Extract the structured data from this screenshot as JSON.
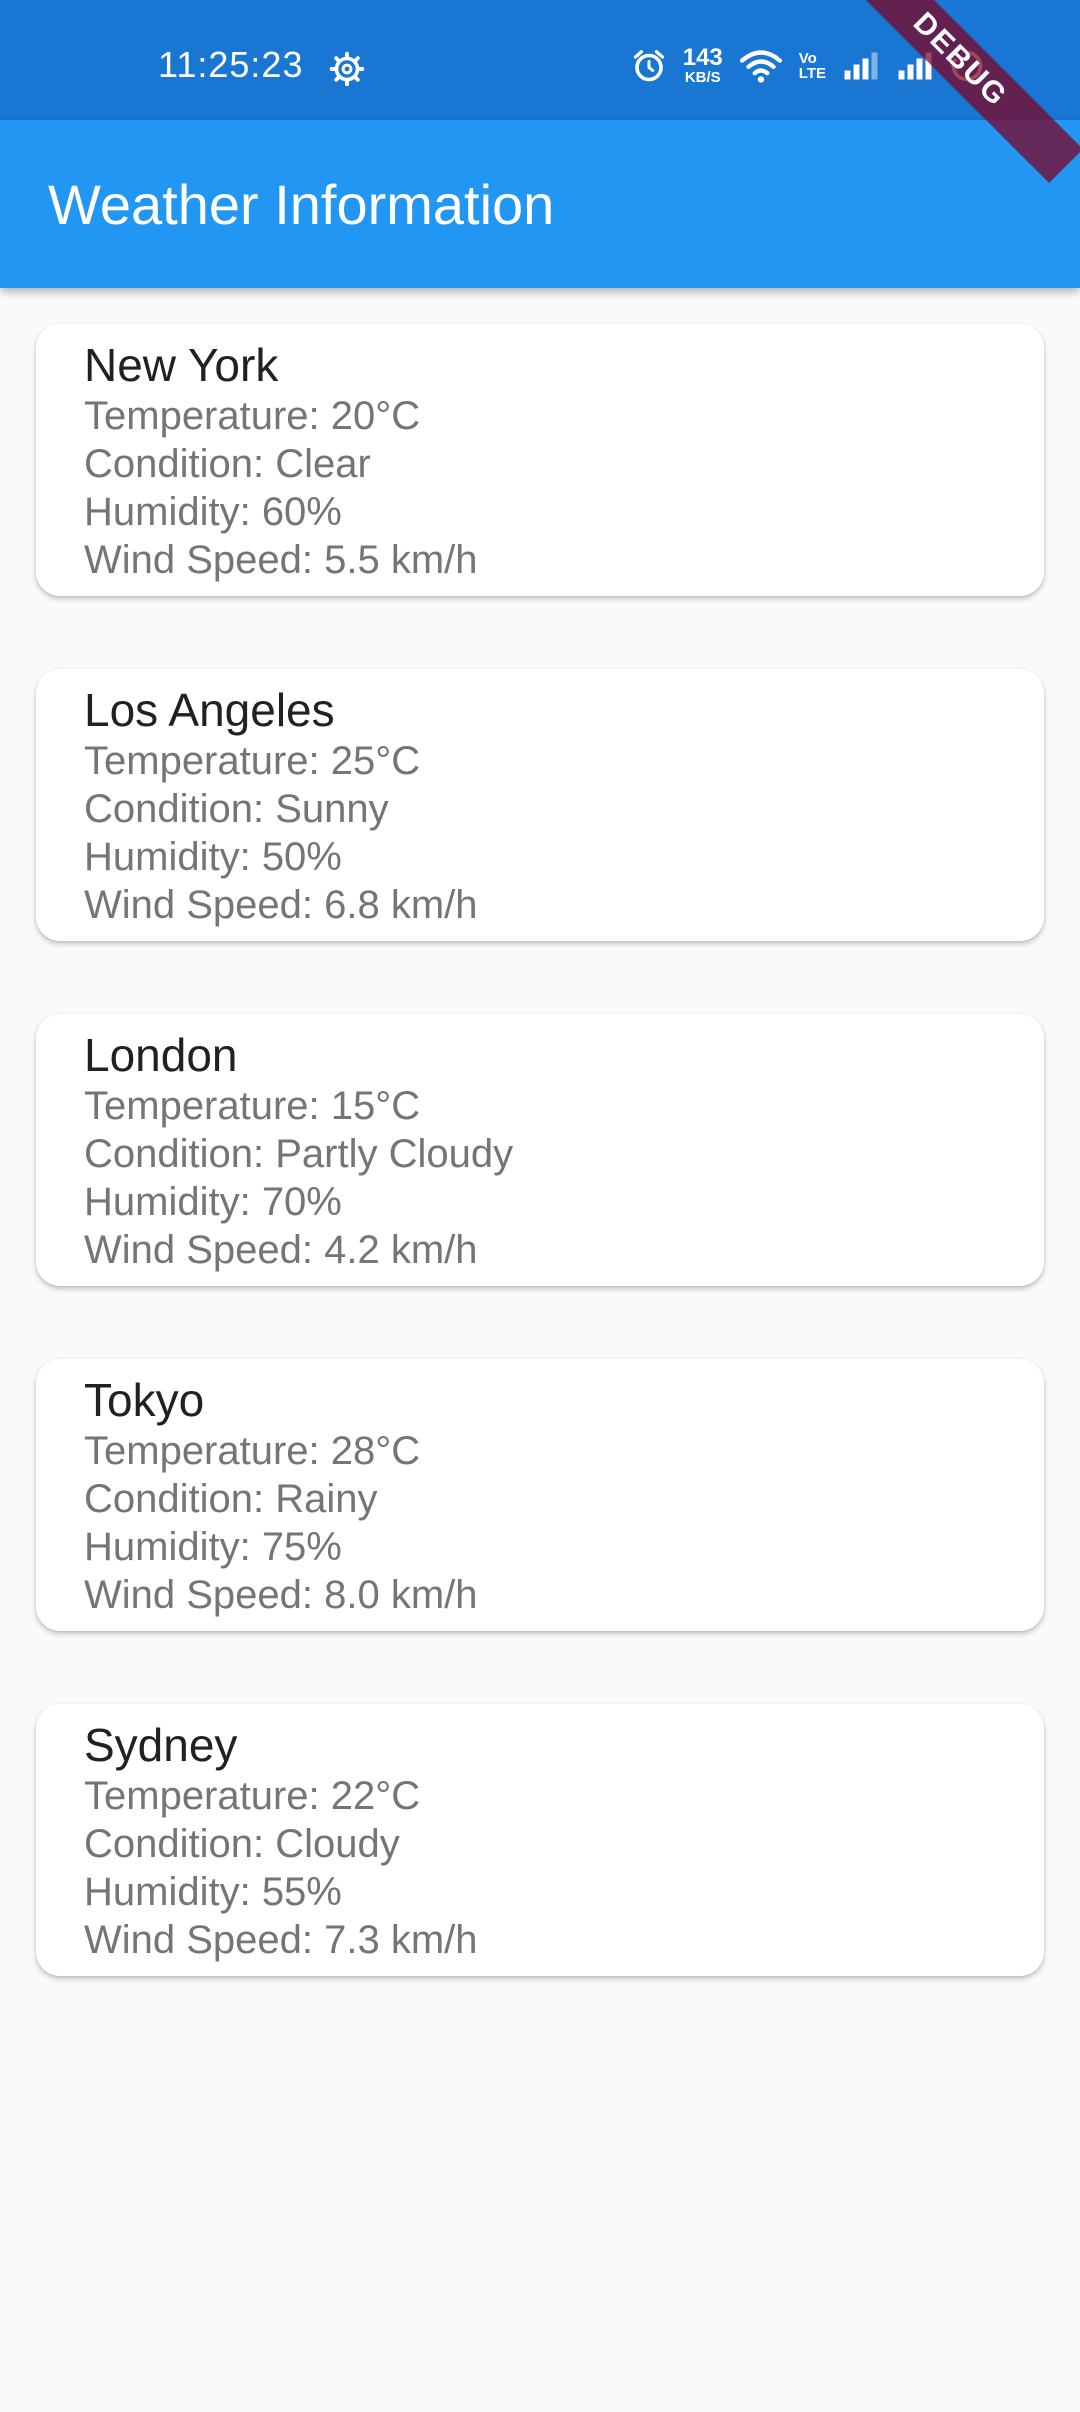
{
  "status_bar": {
    "time": "11:25:23",
    "speed_value": "143",
    "speed_unit": "KB/S",
    "volte_top": "Vo",
    "volte_bottom": "LTE",
    "icons": [
      "gear-icon",
      "alarm-icon",
      "wifi-icon",
      "signal-icon",
      "signal-icon",
      "loading-icon"
    ]
  },
  "debug_banner": "DEBUG",
  "app_bar": {
    "title": "Weather Information"
  },
  "cities": [
    {
      "name": "New York",
      "temperature": "Temperature: 20°C",
      "condition": "Condition: Clear",
      "humidity": "Humidity: 60%",
      "wind": "Wind Speed: 5.5 km/h"
    },
    {
      "name": "Los Angeles",
      "temperature": "Temperature: 25°C",
      "condition": "Condition: Sunny",
      "humidity": "Humidity: 50%",
      "wind": "Wind Speed: 6.8 km/h"
    },
    {
      "name": "London",
      "temperature": "Temperature: 15°C",
      "condition": "Condition: Partly Cloudy",
      "humidity": "Humidity: 70%",
      "wind": "Wind Speed: 4.2 km/h"
    },
    {
      "name": "Tokyo",
      "temperature": "Temperature: 28°C",
      "condition": "Condition: Rainy",
      "humidity": "Humidity: 75%",
      "wind": "Wind Speed: 8.0 km/h"
    },
    {
      "name": "Sydney",
      "temperature": "Temperature: 22°C",
      "condition": "Condition: Cloudy",
      "humidity": "Humidity: 55%",
      "wind": "Wind Speed: 7.3 km/h"
    }
  ],
  "colors": {
    "status_bar": "#1976d2",
    "app_bar": "#2196f3",
    "background": "#fafafa",
    "card": "#ffffff",
    "city_text": "#212121",
    "detail_text": "#757575"
  }
}
